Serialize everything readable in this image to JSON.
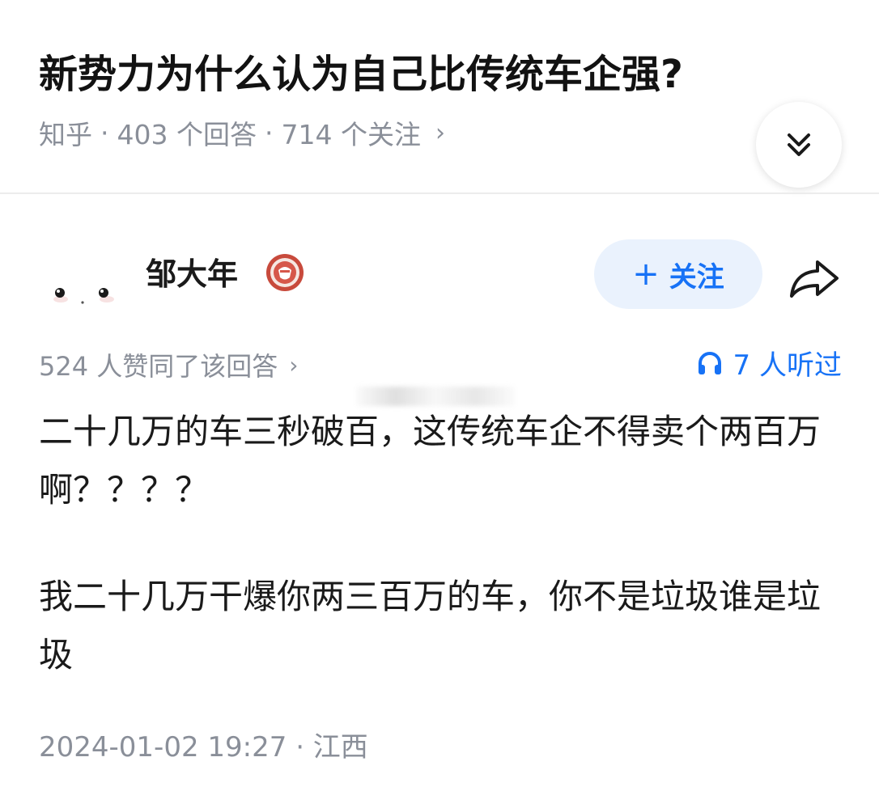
{
  "question": {
    "title": "新势力为什么认为自己比传统车企强?",
    "source": "知乎",
    "answers": "403 个回答",
    "followers": "714 个关注"
  },
  "author": {
    "name": "邹大年",
    "follow_label": "关注"
  },
  "stats": {
    "upvotes": "524 人赞同了该回答",
    "listened": "7 人听过"
  },
  "answer": {
    "paragraphs": [
      "二十几万的车三秒破百，这传统车企不得卖个两百万啊？？？？",
      "我二十几万干爆你两三百万的车，你不是垃圾谁是垃圾"
    ]
  },
  "footer": {
    "timestamp": "2024-01-02 19:27 · 江西"
  },
  "colors": {
    "accent": "#1772f6",
    "follow_bg": "#eaf2fd",
    "meta_gray": "#8a8f99"
  },
  "icons": [
    "expand-icon",
    "plus-icon",
    "share-icon",
    "headphones-icon",
    "badge-icon",
    "chevron-right-icon"
  ]
}
